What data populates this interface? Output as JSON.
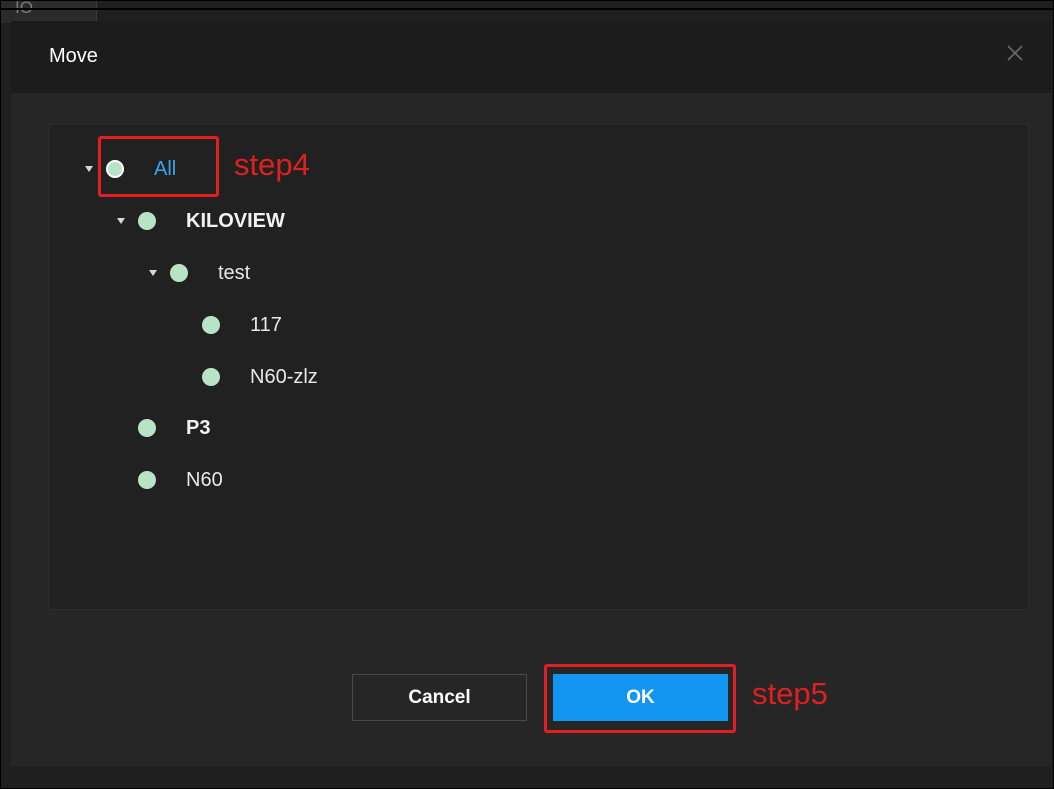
{
  "background_tab": {
    "label": "IO"
  },
  "dialog": {
    "title": "Move",
    "close_icon": "close-icon"
  },
  "tree": {
    "items": [
      {
        "label": "All",
        "level": 0,
        "expanded": true,
        "selected": true
      },
      {
        "label": "KILOVIEW",
        "level": 1,
        "expanded": true,
        "selected": false
      },
      {
        "label": "test",
        "level": 2,
        "expanded": true,
        "selected": false
      },
      {
        "label": "117",
        "level": 3,
        "expanded": false,
        "selected": false
      },
      {
        "label": "N60-zlz",
        "level": 3,
        "expanded": false,
        "selected": false
      },
      {
        "label": "P3",
        "level": 1,
        "expanded": false,
        "selected": false
      },
      {
        "label": "N60",
        "level": 1,
        "expanded": false,
        "selected": false
      }
    ]
  },
  "annotations": {
    "step4": "step4",
    "step5": "step5"
  },
  "buttons": {
    "cancel_label": "Cancel",
    "ok_label": "OK"
  },
  "colors": {
    "accent": "#1296f2",
    "active_text": "#3aa6f0",
    "node_dot": "#b8e3c6",
    "annotation_red": "#e02020",
    "dialog_bg": "#262626"
  }
}
